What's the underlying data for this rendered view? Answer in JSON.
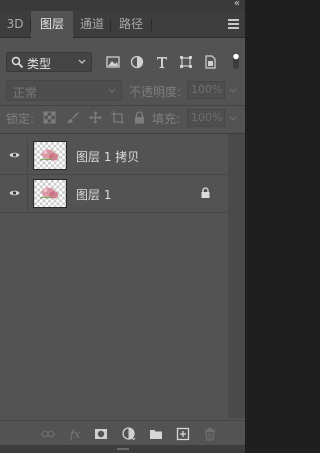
{
  "panel": {
    "collapse_glyph": "«",
    "tabs": [
      {
        "label": "3D",
        "active": false
      },
      {
        "label": "图层",
        "active": true
      },
      {
        "label": "通道",
        "active": false
      },
      {
        "label": "路径",
        "active": false
      }
    ],
    "menu_icon": "panel-menu-icon"
  },
  "filter": {
    "kind_label": "类型",
    "tools": [
      "image-filter-icon",
      "adjustment-filter-icon",
      "type-filter-icon",
      "shape-filter-icon",
      "smart-object-filter-icon"
    ]
  },
  "blend": {
    "mode": "正常",
    "opacity_label": "不透明度:",
    "opacity_value": "100%"
  },
  "lock": {
    "label": "锁定:",
    "tools": [
      "lock-transparent-pixels-icon",
      "lock-image-pixels-icon",
      "lock-position-icon",
      "lock-artboard-icon",
      "lock-all-icon"
    ],
    "fill_label": "填充:",
    "fill_value": "100%"
  },
  "layers": [
    {
      "name": "图层 1 拷贝",
      "visible": true,
      "locked": false
    },
    {
      "name": "图层 1",
      "visible": true,
      "locked": true
    }
  ],
  "bottom_tools": [
    "link-layers-icon",
    "fx-icon",
    "add-mask-icon",
    "new-fill-adjustment-icon",
    "new-group-icon",
    "new-layer-icon",
    "delete-layer-icon"
  ],
  "colors": {
    "panel_bg": "#535353",
    "tabbar_bg": "#3d3d3d",
    "text": "#dcdcdc",
    "dim_text": "#7d7d7d"
  }
}
